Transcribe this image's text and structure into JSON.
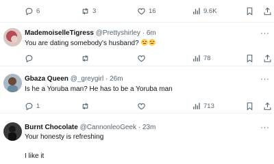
{
  "top_actions": {
    "reply_count": "6",
    "repost_count": "3",
    "like_count": "16",
    "views_count": "9.6K"
  },
  "replies": [
    {
      "name": "MademoiselleTigress",
      "handle": "@Prettyshirley",
      "dot": "·",
      "time": "6m",
      "text": "You are dating somebody's husband?",
      "emojis": [
        "unamused-face-emoji",
        "unamused-face-emoji"
      ],
      "more": "···",
      "actions": {
        "reply_count": "",
        "repost_count": "",
        "like_count": "",
        "views_count": "78"
      },
      "avatar_color": "#b84a5a"
    },
    {
      "name": "Gbaza Queen",
      "handle": "@_greygirl",
      "dot": "·",
      "time": "26m",
      "text": "Is he a Yoruba man? He has to be a Yoruba man",
      "more": "···",
      "actions": {
        "reply_count": "1",
        "repost_count": "",
        "like_count": "",
        "views_count": "713"
      },
      "avatar_color": "#6a8aa0"
    },
    {
      "name": "Burnt Chocolate",
      "handle": "@CannonleoGeek",
      "dot": "·",
      "time": "23m",
      "text": "Your honesty is refreshing",
      "text2": "I like it",
      "more": "···",
      "avatar_color": "#2b2b2b"
    }
  ],
  "icons": {
    "reply": "reply-icon",
    "repost": "repost-icon",
    "like": "like-icon",
    "views": "views-icon",
    "bookmark": "bookmark-icon",
    "share": "share-icon",
    "more": "more-icon"
  },
  "colors": {
    "text_primary": "#0f1419",
    "text_secondary": "#536471",
    "divider": "#eff3f4"
  }
}
